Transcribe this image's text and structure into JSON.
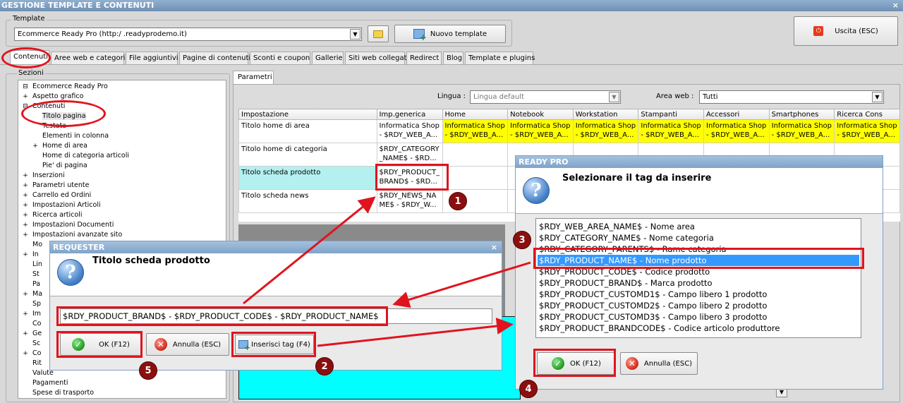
{
  "window": {
    "title": "GESTIONE TEMPLATE E CONTENUTI",
    "close": "×"
  },
  "template": {
    "group_label": "Template",
    "selected": "Ecommerce Ready Pro (http:/       .readyprodemo.it)",
    "new_template_label": "Nuovo template",
    "exit_label": "Uscita (ESC)"
  },
  "tabs": [
    "Contenuti",
    "Aree web e categorie",
    "File aggiuntivi",
    "Pagine di contenuti",
    "Sconti e coupon",
    "Gallerie",
    "Siti web collegati",
    "Redirect",
    "Blog",
    "Template e plugins"
  ],
  "sections": {
    "label": "Sezioni",
    "items": [
      {
        "exp": "⊟",
        "label": "Ecommerce Ready Pro"
      },
      {
        "exp": "+",
        "label": "Aspetto grafico"
      },
      {
        "exp": "⊟",
        "label": "Contenuti"
      },
      {
        "exp": "",
        "label": "Titolo pagina"
      },
      {
        "exp": "",
        "label": "Testata"
      },
      {
        "exp": "",
        "label": "Elementi in colonna"
      },
      {
        "exp": "+",
        "label": "Home di area"
      },
      {
        "exp": "",
        "label": "Home di categoria articoli"
      },
      {
        "exp": "",
        "label": "Pie' di pagina"
      },
      {
        "exp": "+",
        "label": "Inserzioni"
      },
      {
        "exp": "+",
        "label": "Parametri utente"
      },
      {
        "exp": "+",
        "label": "Carrello ed Ordini"
      },
      {
        "exp": "+",
        "label": "Impostazioni Articoli"
      },
      {
        "exp": "+",
        "label": "Ricerca articoli"
      },
      {
        "exp": "+",
        "label": "Impostazioni Documenti"
      },
      {
        "exp": "+",
        "label": "Impostazioni avanzate sito"
      },
      {
        "exp": "",
        "label": "Mo"
      },
      {
        "exp": "+",
        "label": "In"
      },
      {
        "exp": "",
        "label": "Lin"
      },
      {
        "exp": "",
        "label": "St"
      },
      {
        "exp": "",
        "label": "Pa"
      },
      {
        "exp": "+",
        "label": "Ma"
      },
      {
        "exp": "",
        "label": "Sp"
      },
      {
        "exp": "+",
        "label": "Im"
      },
      {
        "exp": "",
        "label": "Co"
      },
      {
        "exp": "+",
        "label": "Ge"
      },
      {
        "exp": "",
        "label": "Sc"
      },
      {
        "exp": "+",
        "label": "Co"
      },
      {
        "exp": "",
        "label": "Rit"
      },
      {
        "exp": "",
        "label": "Valute"
      },
      {
        "exp": "",
        "label": "Pagamenti"
      },
      {
        "exp": "",
        "label": "Spese di trasporto"
      }
    ]
  },
  "params": {
    "tab_label": "Parametri",
    "lingua_label": "Lingua :",
    "lingua_value": "Lingua default",
    "area_label": "Area web :",
    "area_value": "Tutti",
    "columns": [
      "Impostazione",
      "Imp.generica",
      "Home",
      "Notebook",
      "Workstation",
      "Stampanti",
      "Accessori",
      "Smartphones",
      "Ricerca Cons"
    ],
    "rows": [
      {
        "name": "Titolo home di area",
        "generic": "Informatica Shop - $RDY_WEB_A...",
        "area": "Informatica Shop - $RDY_WEB_A..."
      },
      {
        "name": "Titolo home di categoria",
        "generic": "$RDY_CATEGORY _NAME$ - $RD...",
        "area": ""
      },
      {
        "name": "Titolo scheda prodotto",
        "generic": "$RDY_PRODUCT_ BRAND$ - $RD...",
        "area": ""
      },
      {
        "name": "Titolo scheda news",
        "generic": "$RDY_NEWS_NA ME$ - $RDY_W...",
        "area": ""
      }
    ]
  },
  "requester": {
    "title": "REQUESTER",
    "heading": "Titolo scheda prodotto",
    "value": "$RDY_PRODUCT_BRAND$ - $RDY_PRODUCT_CODE$ - $RDY_PRODUCT_NAME$",
    "ok_label": "OK (F12)",
    "cancel_label": "Annulla (ESC)",
    "insert_label": "Inserisci tag (F4)"
  },
  "tag_dialog": {
    "title": "READY PRO",
    "heading": "Selezionare il tag da inserire",
    "items": [
      "$RDY_WEB_AREA_NAME$ - Nome area",
      "$RDY_CATEGORY_NAME$ - Nome categoria",
      "$RDY_CATEGORY_PARENTS$ - Rame categoria",
      "$RDY_PRODUCT_NAME$ - Nome prodotto",
      "$RDY_PRODUCT_CODE$ - Codice prodotto",
      "$RDY_PRODUCT_BRAND$ - Marca prodotto",
      "$RDY_PRODUCT_CUSTOMD1$ - Campo libero 1 prodotto",
      "$RDY_PRODUCT_CUSTOMD2$ - Campo libero 2 prodotto",
      "$RDY_PRODUCT_CUSTOMD3$ - Campo libero 3 prodotto",
      "$RDY_PRODUCT_BRANDCODE$ - Codice articolo produttore"
    ],
    "selected_index": 3,
    "ok_label": "OK (F12)",
    "cancel_label": "Annulla (ESC)"
  },
  "badges": [
    "1",
    "2",
    "3",
    "4",
    "5"
  ],
  "colors": {
    "annotation_red": "#e0141e",
    "badge": "#8a1010",
    "selection": "#3399ff",
    "highlight_yellow": "#ffff00",
    "cyan_area": "#00ffff"
  }
}
